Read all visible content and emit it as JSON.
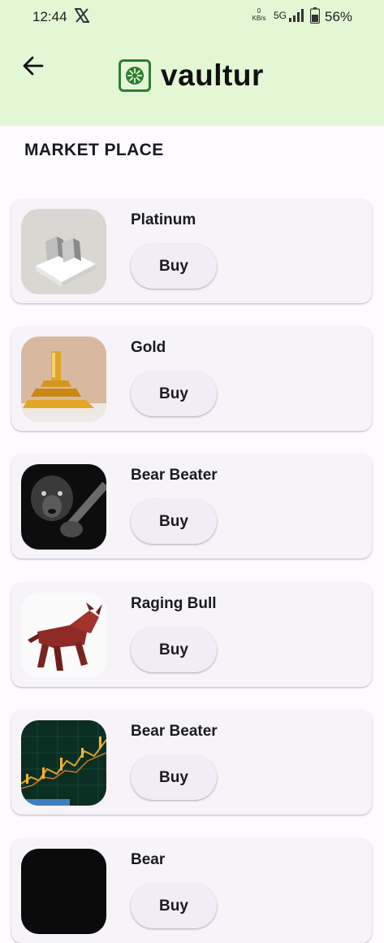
{
  "status_bar": {
    "time": "12:44",
    "net_speed_value": "0",
    "net_speed_unit": "KB/s",
    "network": "5G",
    "battery": "56%"
  },
  "header": {
    "app_name": "vaultur",
    "back_icon": "arrow-left-icon",
    "logo_icon": "vaultur-logo-icon"
  },
  "page": {
    "title": "MARKET PLACE"
  },
  "colors": {
    "header_bg": "#e3f7d5",
    "card_bg": "#f6f4f9",
    "button_bg": "#f2ecf6",
    "logo_green": "#2e7d32"
  },
  "products": [
    {
      "name": "Platinum",
      "buy_label": "Buy",
      "image": "platinum-bars-image"
    },
    {
      "name": "Gold",
      "buy_label": "Buy",
      "image": "gold-bars-image"
    },
    {
      "name": "Bear Beater",
      "buy_label": "Buy",
      "image": "bear-image"
    },
    {
      "name": "Raging Bull",
      "buy_label": "Buy",
      "image": "bull-image"
    },
    {
      "name": "Bear Beater",
      "buy_label": "Buy",
      "image": "stock-chart-image"
    },
    {
      "name": "Bear",
      "buy_label": "Buy",
      "image": "dark-image"
    }
  ]
}
